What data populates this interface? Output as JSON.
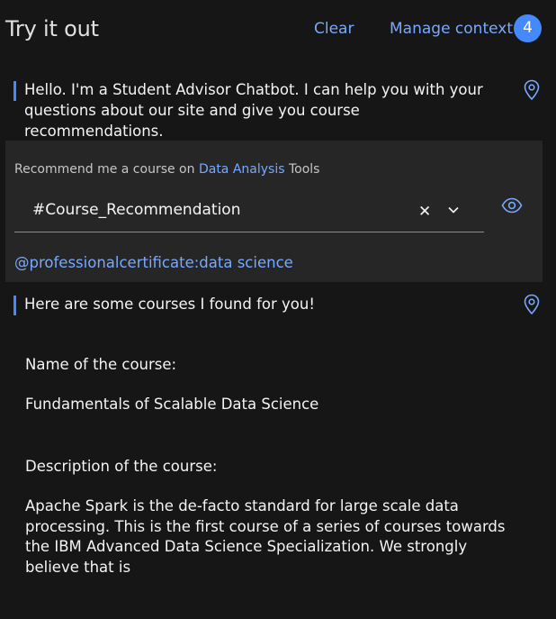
{
  "header": {
    "title": "Try it out",
    "clear_label": "Clear",
    "manage_context_label": "Manage context",
    "context_count": "4"
  },
  "messages": {
    "greeting": "Hello. I'm a Student Advisor Chatbot. I can help you with your questions about our site and give you course recommendations.",
    "reply_intro": "Here are some courses I found for you!"
  },
  "user_input": {
    "prefix": "Recommend me a course on ",
    "highlight": "Data Analysis",
    "suffix": " Tools",
    "intent": "#Course_Recommendation",
    "entity": "@professionalcertificate:data science"
  },
  "course": {
    "name_label": "Name of the course:",
    "name_value": "Fundamentals of Scalable Data Science",
    "description_label": "Description of the course:",
    "description_value": "Apache Spark is the de-facto standard for large scale data processing. This is the first course of a series of courses towards the IBM Advanced Data Science Specialization. We strongly believe that is"
  },
  "icons": {
    "pin": "map-pin-icon",
    "eye": "eye-icon",
    "close": "close-icon",
    "chevron": "chevron-down-icon"
  },
  "colors": {
    "background": "#161616",
    "panel": "#262626",
    "accent": "#78a9ff",
    "badge": "#4589ff"
  }
}
